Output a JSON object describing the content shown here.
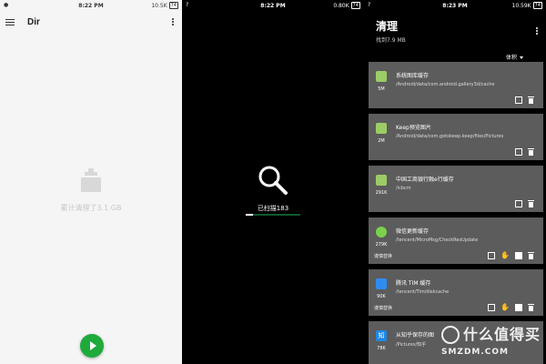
{
  "screen1": {
    "status": {
      "time": "8:22 PM",
      "speed": "10.5K",
      "battery": "74"
    },
    "title": "Dir",
    "empty_text": "累计清理了3.1 GB",
    "fab_icon": "play-icon"
  },
  "screen2": {
    "status": {
      "time": "8:22 PM",
      "speed": "0.80K",
      "battery": "74"
    },
    "scan_icon": "search-icon",
    "scan_text": "已扫描183",
    "progress_fraction": 0.14
  },
  "screen3": {
    "status": {
      "time": "8:23 PM",
      "speed": "10.59K",
      "battery": "74"
    },
    "title": "清理",
    "subtitle": "找到7.9 MB",
    "sort_label": "体积",
    "items": [
      {
        "name": "系统图库缓存",
        "path": "/Android/data/com.android.gallery3d/cache",
        "size": "5M",
        "icon": "android-icon",
        "note": ""
      },
      {
        "name": "Keep预览图片",
        "path": "/Android/data/com.gotokeep.keep/files/Pictures",
        "size": "2M",
        "icon": "android-icon",
        "note": ""
      },
      {
        "name": "中国工商银行融e行缓存",
        "path": "/icbcm",
        "size": "291K",
        "icon": "android-icon",
        "note": ""
      },
      {
        "name": "微信更新缓存",
        "path": "/tencent/MicroMsg/CheckResUpdate",
        "size": "279K",
        "icon": "wechat-icon",
        "note": "谨慎替换"
      },
      {
        "name": "腾讯 TIM 缓存",
        "path": "/tencent/Tim/diskcache",
        "size": "90K",
        "icon": "tim-icon",
        "note": "谨慎替换"
      },
      {
        "name": "从知乎保存的图",
        "path": "/Pictures/知乎",
        "size": "78K",
        "icon": "zhihu-icon",
        "note": ""
      }
    ],
    "zhihu_glyph": "知"
  },
  "watermark": {
    "line1": "什么值得买",
    "line2": "SMZDM.COM"
  },
  "colors": {
    "fab": "#1faa3c",
    "card": "#5c5c5c",
    "progress_track": "#0e5a2a"
  }
}
